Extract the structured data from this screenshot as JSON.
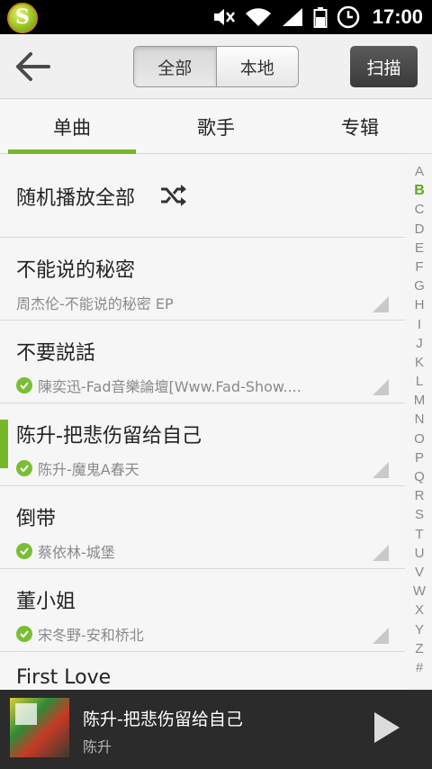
{
  "status_bar": {
    "time": "17:00"
  },
  "toolbar": {
    "segments": [
      "全部",
      "本地"
    ],
    "active_segment": "全部",
    "scan_label": "扫描"
  },
  "tabs": [
    {
      "label": "单曲",
      "active": true
    },
    {
      "label": "歌手",
      "active": false
    },
    {
      "label": "专辑",
      "active": false
    }
  ],
  "shuffle": {
    "label": "随机播放全部"
  },
  "songs": [
    {
      "title": "不能说的秘密",
      "subtitle": "周杰伦-不能说的秘密 EP",
      "downloaded": false,
      "playing": false
    },
    {
      "title": "不要説話",
      "subtitle": "陳奕迅-Fad音樂論壇[Www.Fad-Show....",
      "downloaded": true,
      "playing": false
    },
    {
      "title": "陈升-把悲伤留给自己",
      "subtitle": "陈升-魔鬼A春天",
      "downloaded": true,
      "playing": true
    },
    {
      "title": "倒带",
      "subtitle": "蔡依林-城堡",
      "downloaded": true,
      "playing": false
    },
    {
      "title": "董小姐",
      "subtitle": "宋冬野-安和桥北",
      "downloaded": true,
      "playing": false
    },
    {
      "title": "First Love",
      "subtitle": "",
      "downloaded": false,
      "playing": false
    }
  ],
  "index": {
    "letters": [
      "A",
      "B",
      "C",
      "D",
      "E",
      "F",
      "G",
      "H",
      "I",
      "J",
      "K",
      "L",
      "M",
      "N",
      "O",
      "P",
      "Q",
      "R",
      "S",
      "T",
      "U",
      "V",
      "W",
      "X",
      "Y",
      "Z",
      "#"
    ],
    "selected": "B"
  },
  "now_playing": {
    "title": "陈升-把悲伤留给自己",
    "artist": "陈升"
  },
  "colors": {
    "accent": "#78b72a",
    "statusbar": "#000000",
    "nowbar": "#2b2b2b"
  }
}
